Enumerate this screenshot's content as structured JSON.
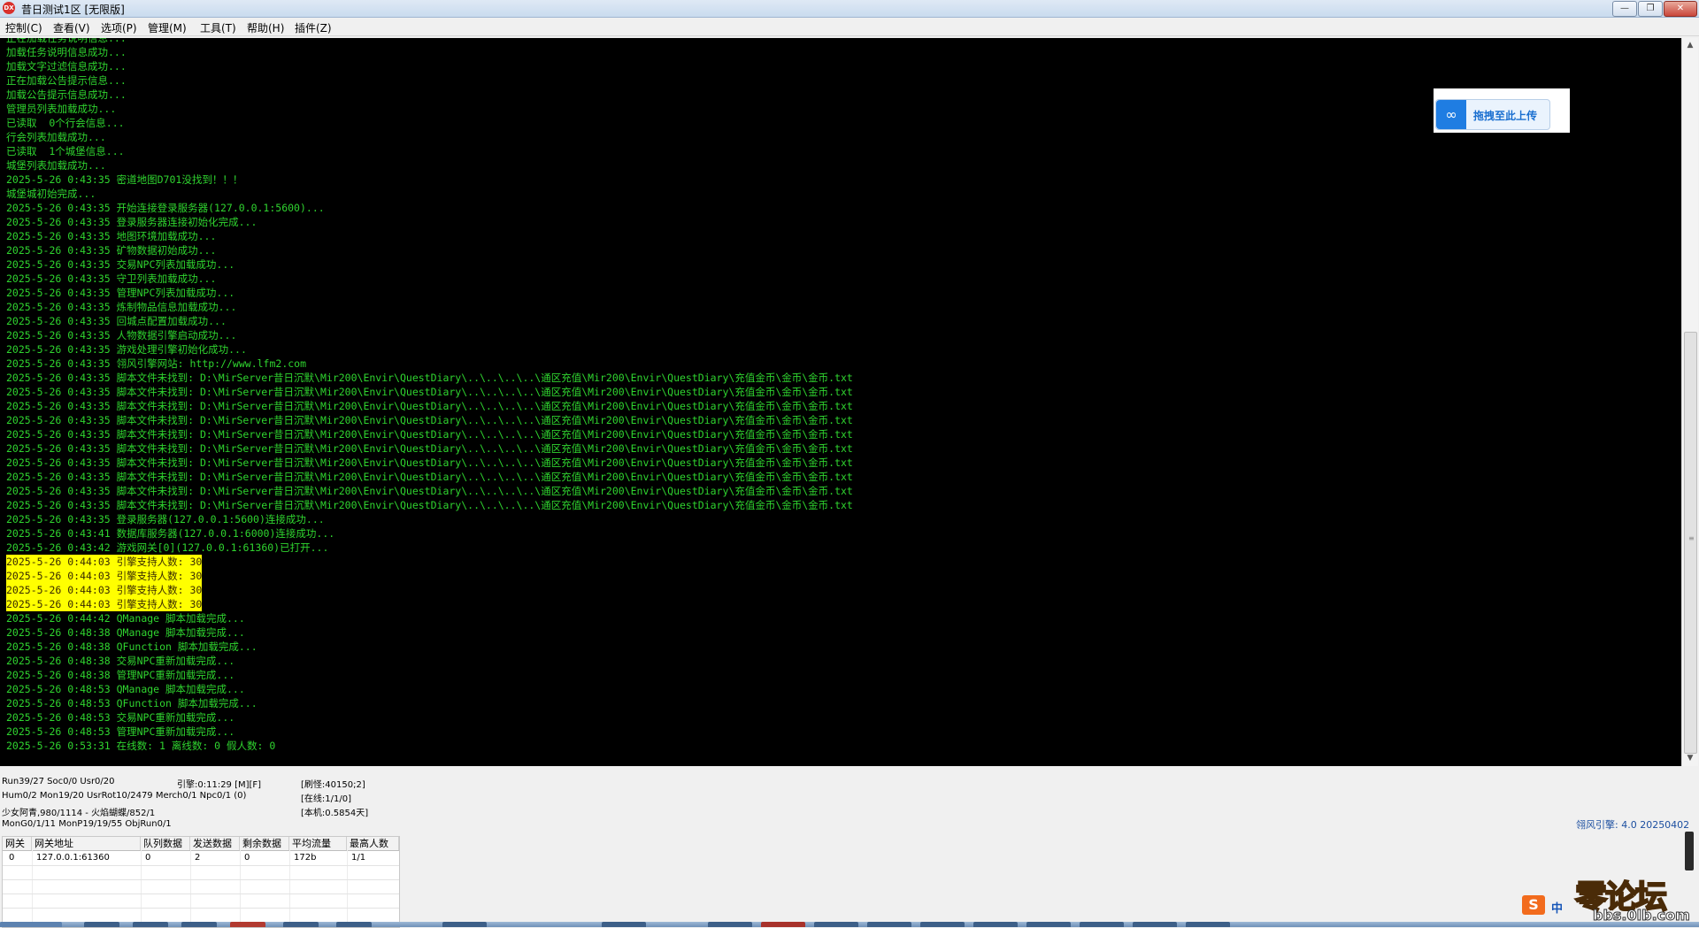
{
  "window": {
    "title": "昔日测试1区 [无限版]",
    "icon_label": "DX",
    "minimize_label": "—",
    "maximize_label": "❐",
    "close_label": "✕"
  },
  "menu": {
    "items": [
      {
        "label": "控制(C)"
      },
      {
        "label": "查看(V)"
      },
      {
        "label": "选项(P)"
      },
      {
        "label": "管理(M)"
      },
      {
        "label": "工具(T)"
      },
      {
        "label": "帮助(H)"
      },
      {
        "label": "插件(Z)"
      }
    ]
  },
  "log": {
    "lines": [
      {
        "text": "正在加载任务说明信息...",
        "highlight": false
      },
      {
        "text": "加载任务说明信息成功...",
        "highlight": false
      },
      {
        "text": "加载文字过滤信息成功...",
        "highlight": false
      },
      {
        "text": "正在加载公告提示信息...",
        "highlight": false
      },
      {
        "text": "加载公告提示信息成功...",
        "highlight": false
      },
      {
        "text": "管理员列表加载成功...",
        "highlight": false
      },
      {
        "text": "已读取  0个行会信息...",
        "highlight": false
      },
      {
        "text": "行会列表加载成功...",
        "highlight": false
      },
      {
        "text": "已读取  1个城堡信息...",
        "highlight": false
      },
      {
        "text": "城堡列表加载成功...",
        "highlight": false
      },
      {
        "text": "2025-5-26 0:43:35 密道地图D701没找到！！！",
        "highlight": false
      },
      {
        "text": "城堡城初始完成...",
        "highlight": false
      },
      {
        "text": "2025-5-26 0:43:35 开始连接登录服务器(127.0.0.1:5600)...",
        "highlight": false
      },
      {
        "text": "2025-5-26 0:43:35 登录服务器连接初始化完成...",
        "highlight": false
      },
      {
        "text": "2025-5-26 0:43:35 地图环境加载成功...",
        "highlight": false
      },
      {
        "text": "2025-5-26 0:43:35 矿物数据初始成功...",
        "highlight": false
      },
      {
        "text": "2025-5-26 0:43:35 交易NPC列表加载成功...",
        "highlight": false
      },
      {
        "text": "2025-5-26 0:43:35 守卫列表加载成功...",
        "highlight": false
      },
      {
        "text": "2025-5-26 0:43:35 管理NPC列表加载成功...",
        "highlight": false
      },
      {
        "text": "2025-5-26 0:43:35 炼制物品信息加载成功...",
        "highlight": false
      },
      {
        "text": "2025-5-26 0:43:35 回城点配置加载成功...",
        "highlight": false
      },
      {
        "text": "2025-5-26 0:43:35 人物数据引擎启动成功...",
        "highlight": false
      },
      {
        "text": "2025-5-26 0:43:35 游戏处理引擎初始化成功...",
        "highlight": false
      },
      {
        "text": "2025-5-26 0:43:35 翎风引擎网站: http://www.lfm2.com",
        "highlight": false
      },
      {
        "text": "2025-5-26 0:43:35 脚本文件未找到: D:\\MirServer昔日沉默\\Mir200\\Envir\\QuestDiary\\..\\..\\..\\..\\通区充值\\Mir200\\Envir\\QuestDiary\\充值金币\\金币\\金币.txt",
        "highlight": false
      },
      {
        "text": "2025-5-26 0:43:35 脚本文件未找到: D:\\MirServer昔日沉默\\Mir200\\Envir\\QuestDiary\\..\\..\\..\\..\\通区充值\\Mir200\\Envir\\QuestDiary\\充值金币\\金币\\金币.txt",
        "highlight": false
      },
      {
        "text": "2025-5-26 0:43:35 脚本文件未找到: D:\\MirServer昔日沉默\\Mir200\\Envir\\QuestDiary\\..\\..\\..\\..\\通区充值\\Mir200\\Envir\\QuestDiary\\充值金币\\金币\\金币.txt",
        "highlight": false
      },
      {
        "text": "2025-5-26 0:43:35 脚本文件未找到: D:\\MirServer昔日沉默\\Mir200\\Envir\\QuestDiary\\..\\..\\..\\..\\通区充值\\Mir200\\Envir\\QuestDiary\\充值金币\\金币\\金币.txt",
        "highlight": false
      },
      {
        "text": "2025-5-26 0:43:35 脚本文件未找到: D:\\MirServer昔日沉默\\Mir200\\Envir\\QuestDiary\\..\\..\\..\\..\\通区充值\\Mir200\\Envir\\QuestDiary\\充值金币\\金币\\金币.txt",
        "highlight": false
      },
      {
        "text": "2025-5-26 0:43:35 脚本文件未找到: D:\\MirServer昔日沉默\\Mir200\\Envir\\QuestDiary\\..\\..\\..\\..\\通区充值\\Mir200\\Envir\\QuestDiary\\充值金币\\金币\\金币.txt",
        "highlight": false
      },
      {
        "text": "2025-5-26 0:43:35 脚本文件未找到: D:\\MirServer昔日沉默\\Mir200\\Envir\\QuestDiary\\..\\..\\..\\..\\通区充值\\Mir200\\Envir\\QuestDiary\\充值金币\\金币\\金币.txt",
        "highlight": false
      },
      {
        "text": "2025-5-26 0:43:35 脚本文件未找到: D:\\MirServer昔日沉默\\Mir200\\Envir\\QuestDiary\\..\\..\\..\\..\\通区充值\\Mir200\\Envir\\QuestDiary\\充值金币\\金币\\金币.txt",
        "highlight": false
      },
      {
        "text": "2025-5-26 0:43:35 脚本文件未找到: D:\\MirServer昔日沉默\\Mir200\\Envir\\QuestDiary\\..\\..\\..\\..\\通区充值\\Mir200\\Envir\\QuestDiary\\充值金币\\金币\\金币.txt",
        "highlight": false
      },
      {
        "text": "2025-5-26 0:43:35 脚本文件未找到: D:\\MirServer昔日沉默\\Mir200\\Envir\\QuestDiary\\..\\..\\..\\..\\通区充值\\Mir200\\Envir\\QuestDiary\\充值金币\\金币\\金币.txt",
        "highlight": false
      },
      {
        "text": "2025-5-26 0:43:35 登录服务器(127.0.0.1:5600)连接成功...",
        "highlight": false
      },
      {
        "text": "2025-5-26 0:43:41 数据库服务器(127.0.0.1:6000)连接成功...",
        "highlight": false
      },
      {
        "text": "2025-5-26 0:43:42 游戏网关[0](127.0.0.1:61360)已打开...",
        "highlight": false
      },
      {
        "text": "2025-5-26 0:44:03 引擎支持人数: 30",
        "highlight": true
      },
      {
        "text": "2025-5-26 0:44:03 引擎支持人数: 30",
        "highlight": true
      },
      {
        "text": "2025-5-26 0:44:03 引擎支持人数: 30",
        "highlight": true
      },
      {
        "text": "2025-5-26 0:44:03 引擎支持人数: 30",
        "highlight": true
      },
      {
        "text": "2025-5-26 0:44:42 QManage 脚本加载完成...",
        "highlight": false
      },
      {
        "text": "2025-5-26 0:48:38 QManage 脚本加载完成...",
        "highlight": false
      },
      {
        "text": "2025-5-26 0:48:38 QFunction 脚本加载完成...",
        "highlight": false
      },
      {
        "text": "2025-5-26 0:48:38 交易NPC重新加载完成...",
        "highlight": false
      },
      {
        "text": "2025-5-26 0:48:38 管理NPC重新加载完成...",
        "highlight": false
      },
      {
        "text": "2025-5-26 0:48:53 QManage 脚本加载完成...",
        "highlight": false
      },
      {
        "text": "2025-5-26 0:48:53 QFunction 脚本加载完成...",
        "highlight": false
      },
      {
        "text": "2025-5-26 0:48:53 交易NPC重新加载完成...",
        "highlight": false
      },
      {
        "text": "2025-5-26 0:48:53 管理NPC重新加载完成...",
        "highlight": false
      },
      {
        "text": "2025-5-26 0:53:31 在线数: 1 离线数: 0 假人数: 0",
        "highlight": false
      }
    ]
  },
  "upload_widget": {
    "label": "拖拽至此上传",
    "icon": "cloud-upload-icon"
  },
  "status": {
    "line1": "Run39/27 Soc0/0 Usr0/20",
    "engine_time": "引擎:0:11:29 [M][F]",
    "refresh": "[刷怪:40150;2]",
    "line2": "Hum0/2 Mon19/20 UsrRot10/2479 Merch0/1 Npc0/1 (0)",
    "online": "[在线:1/1/0]",
    "line3": "少女阿青,980/1114 - 火焰蝴蝶/852/1",
    "machine": "[本机:0.5854天]",
    "line4": "MonG0/1/11 MonP19/19/55 ObjRun0/1",
    "version": "翎风引擎: 4.0 20250402"
  },
  "gateway_table": {
    "headers": [
      "网关",
      "网关地址",
      "队列数据",
      "发送数据",
      "剩余数据",
      "平均流量",
      "最高人数"
    ],
    "rows": [
      [
        "0",
        "127.0.0.1:61360",
        "0",
        "2",
        "0",
        "172b",
        "1/1"
      ]
    ]
  },
  "watermark": {
    "ime_logo": "S",
    "ime_lang": "中",
    "site_text": "零",
    "site_text2": "论坛",
    "site_url": "bbs.0lb.com"
  },
  "colors": {
    "console_bg": "#000000",
    "console_text": "#2fd42f",
    "highlight_bg": "#ffff00"
  }
}
